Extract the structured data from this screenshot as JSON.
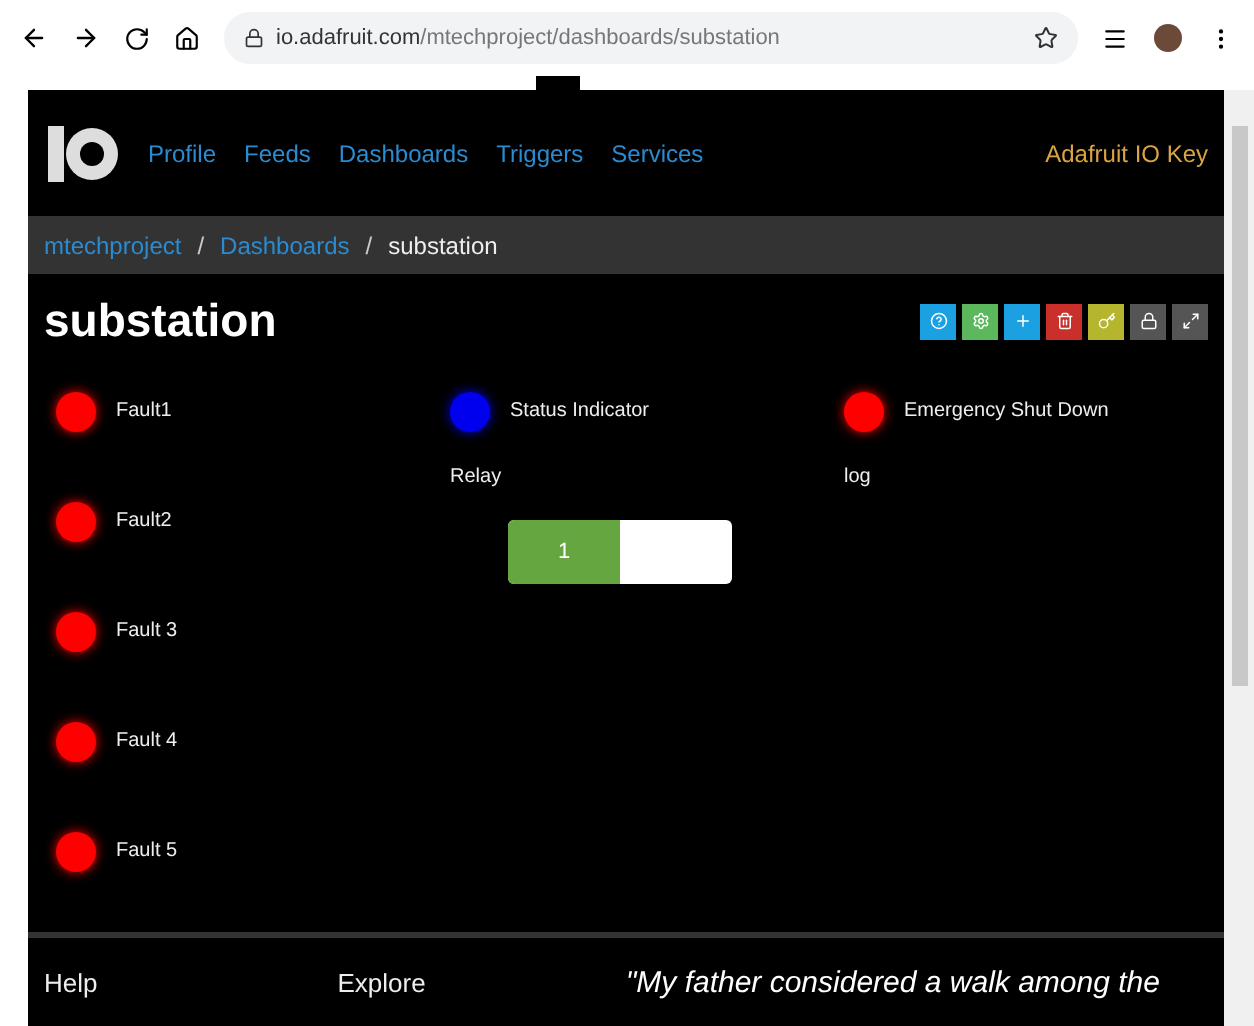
{
  "browser": {
    "url_host": "io.adafruit.com",
    "url_path": "/mtechproject/dashboards/substation"
  },
  "nav": {
    "items": [
      "Profile",
      "Feeds",
      "Dashboards",
      "Triggers",
      "Services"
    ],
    "key_link": "Adafruit IO Key"
  },
  "breadcrumb_separator": "/",
  "breadcrumb": [
    {
      "label": "mtechproject",
      "link": true
    },
    {
      "label": "Dashboards",
      "link": true
    },
    {
      "label": "substation",
      "link": false
    }
  ],
  "dashboard": {
    "title": "substation",
    "tools": [
      {
        "kind": "help",
        "color": "#1ba1e2"
      },
      {
        "kind": "settings",
        "color": "#5cb85c"
      },
      {
        "kind": "add",
        "color": "#1ba1e2"
      },
      {
        "kind": "delete",
        "color": "#c9302c"
      },
      {
        "kind": "key",
        "color": "#b5b52e"
      },
      {
        "kind": "lock",
        "color": "#555555"
      },
      {
        "kind": "expand",
        "color": "#555555"
      }
    ],
    "indicators": [
      {
        "label": "Fault1",
        "color": "#ff0000"
      },
      {
        "label": "Fault2",
        "color": "#ff0000"
      },
      {
        "label": "Fault 3",
        "color": "#ff0000"
      },
      {
        "label": "Fault 4",
        "color": "#ff0000"
      },
      {
        "label": "Fault 5",
        "color": "#ff0000"
      }
    ],
    "middle": {
      "indicator": {
        "label": "Status Indicator",
        "color": "#0000ee"
      },
      "toggle": {
        "label": "Relay",
        "value": "1",
        "on": true
      }
    },
    "right": {
      "indicator": {
        "label": "Emergency Shut Down",
        "color": "#ff0000"
      },
      "log": {
        "label": "log"
      }
    }
  },
  "footer": {
    "columns": [
      "Help",
      "Explore"
    ],
    "quote": "\"My father considered a walk among the"
  }
}
